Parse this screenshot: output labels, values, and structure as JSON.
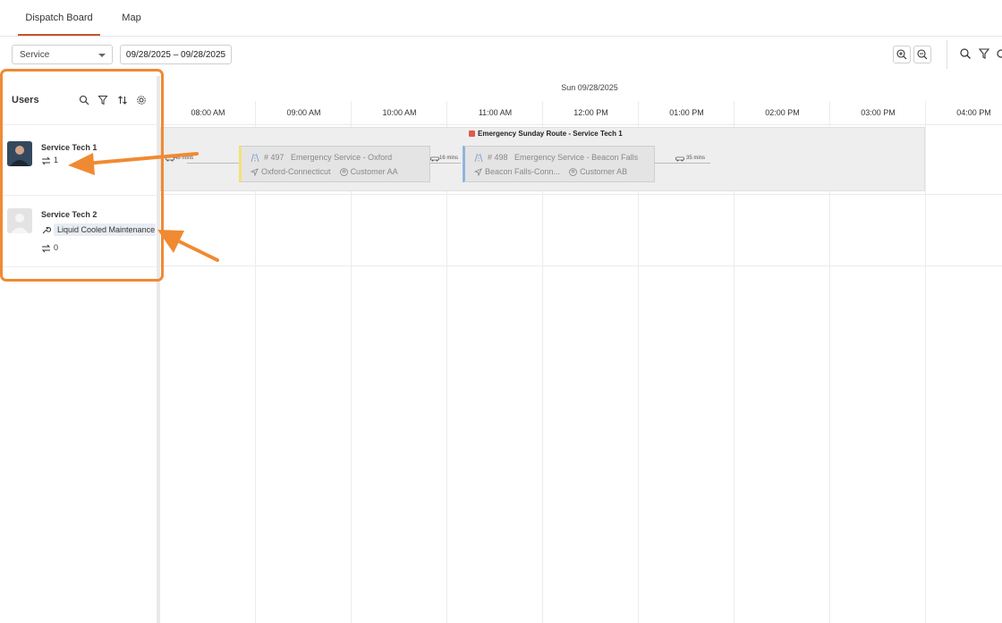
{
  "tabs": [
    {
      "label": "Dispatch Board",
      "active": true
    },
    {
      "label": "Map",
      "active": false
    }
  ],
  "toolbar": {
    "service_select": "Service",
    "date_range": "09/28/2025 – 09/28/2025"
  },
  "users_panel": {
    "title": "Users",
    "users": [
      {
        "name": "Service Tech 1",
        "route_count": "1"
      },
      {
        "name": "Service Tech 2",
        "skill": "Liquid Cooled Maintenance",
        "route_count": "0"
      }
    ]
  },
  "timeline": {
    "date": "Sun 09/28/2025",
    "hours": [
      "08:00 AM",
      "09:00 AM",
      "10:00 AM",
      "11:00 AM",
      "12:00 PM",
      "01:00 PM",
      "02:00 PM",
      "03:00 PM",
      "04:00 PM"
    ],
    "route": {
      "title": "Emergency Sunday Route - Service Tech 1",
      "color": "#e05a4e",
      "travel_1": "48 mins",
      "travel_2": "16 mins",
      "travel_3": "35 mins",
      "jobs": [
        {
          "number": "# 497",
          "title": "Emergency Service - Oxford",
          "location": "Oxford-Connecticut",
          "customer": "Customer AA",
          "accent": "#f2e27a"
        },
        {
          "number": "# 498",
          "title": "Emergency Service - Beacon Falls",
          "location": "Beacon Falls-Conn...",
          "customer": "Customer AB",
          "accent": "#8fb4e0"
        }
      ]
    }
  },
  "colors": {
    "accent": "#c8552a",
    "annotation": "#f08a32"
  }
}
